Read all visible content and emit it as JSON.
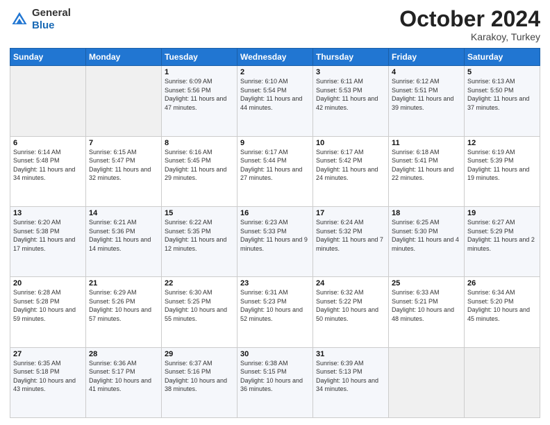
{
  "header": {
    "logo": {
      "general": "General",
      "blue": "Blue"
    },
    "title": "October 2024",
    "location": "Karakoy, Turkey"
  },
  "days_of_week": [
    "Sunday",
    "Monday",
    "Tuesday",
    "Wednesday",
    "Thursday",
    "Friday",
    "Saturday"
  ],
  "weeks": [
    [
      {
        "day": "",
        "info": ""
      },
      {
        "day": "",
        "info": ""
      },
      {
        "day": "1",
        "sunrise": "Sunrise: 6:09 AM",
        "sunset": "Sunset: 5:56 PM",
        "daylight": "Daylight: 11 hours and 47 minutes."
      },
      {
        "day": "2",
        "sunrise": "Sunrise: 6:10 AM",
        "sunset": "Sunset: 5:54 PM",
        "daylight": "Daylight: 11 hours and 44 minutes."
      },
      {
        "day": "3",
        "sunrise": "Sunrise: 6:11 AM",
        "sunset": "Sunset: 5:53 PM",
        "daylight": "Daylight: 11 hours and 42 minutes."
      },
      {
        "day": "4",
        "sunrise": "Sunrise: 6:12 AM",
        "sunset": "Sunset: 5:51 PM",
        "daylight": "Daylight: 11 hours and 39 minutes."
      },
      {
        "day": "5",
        "sunrise": "Sunrise: 6:13 AM",
        "sunset": "Sunset: 5:50 PM",
        "daylight": "Daylight: 11 hours and 37 minutes."
      }
    ],
    [
      {
        "day": "6",
        "sunrise": "Sunrise: 6:14 AM",
        "sunset": "Sunset: 5:48 PM",
        "daylight": "Daylight: 11 hours and 34 minutes."
      },
      {
        "day": "7",
        "sunrise": "Sunrise: 6:15 AM",
        "sunset": "Sunset: 5:47 PM",
        "daylight": "Daylight: 11 hours and 32 minutes."
      },
      {
        "day": "8",
        "sunrise": "Sunrise: 6:16 AM",
        "sunset": "Sunset: 5:45 PM",
        "daylight": "Daylight: 11 hours and 29 minutes."
      },
      {
        "day": "9",
        "sunrise": "Sunrise: 6:17 AM",
        "sunset": "Sunset: 5:44 PM",
        "daylight": "Daylight: 11 hours and 27 minutes."
      },
      {
        "day": "10",
        "sunrise": "Sunrise: 6:17 AM",
        "sunset": "Sunset: 5:42 PM",
        "daylight": "Daylight: 11 hours and 24 minutes."
      },
      {
        "day": "11",
        "sunrise": "Sunrise: 6:18 AM",
        "sunset": "Sunset: 5:41 PM",
        "daylight": "Daylight: 11 hours and 22 minutes."
      },
      {
        "day": "12",
        "sunrise": "Sunrise: 6:19 AM",
        "sunset": "Sunset: 5:39 PM",
        "daylight": "Daylight: 11 hours and 19 minutes."
      }
    ],
    [
      {
        "day": "13",
        "sunrise": "Sunrise: 6:20 AM",
        "sunset": "Sunset: 5:38 PM",
        "daylight": "Daylight: 11 hours and 17 minutes."
      },
      {
        "day": "14",
        "sunrise": "Sunrise: 6:21 AM",
        "sunset": "Sunset: 5:36 PM",
        "daylight": "Daylight: 11 hours and 14 minutes."
      },
      {
        "day": "15",
        "sunrise": "Sunrise: 6:22 AM",
        "sunset": "Sunset: 5:35 PM",
        "daylight": "Daylight: 11 hours and 12 minutes."
      },
      {
        "day": "16",
        "sunrise": "Sunrise: 6:23 AM",
        "sunset": "Sunset: 5:33 PM",
        "daylight": "Daylight: 11 hours and 9 minutes."
      },
      {
        "day": "17",
        "sunrise": "Sunrise: 6:24 AM",
        "sunset": "Sunset: 5:32 PM",
        "daylight": "Daylight: 11 hours and 7 minutes."
      },
      {
        "day": "18",
        "sunrise": "Sunrise: 6:25 AM",
        "sunset": "Sunset: 5:30 PM",
        "daylight": "Daylight: 11 hours and 4 minutes."
      },
      {
        "day": "19",
        "sunrise": "Sunrise: 6:27 AM",
        "sunset": "Sunset: 5:29 PM",
        "daylight": "Daylight: 11 hours and 2 minutes."
      }
    ],
    [
      {
        "day": "20",
        "sunrise": "Sunrise: 6:28 AM",
        "sunset": "Sunset: 5:28 PM",
        "daylight": "Daylight: 10 hours and 59 minutes."
      },
      {
        "day": "21",
        "sunrise": "Sunrise: 6:29 AM",
        "sunset": "Sunset: 5:26 PM",
        "daylight": "Daylight: 10 hours and 57 minutes."
      },
      {
        "day": "22",
        "sunrise": "Sunrise: 6:30 AM",
        "sunset": "Sunset: 5:25 PM",
        "daylight": "Daylight: 10 hours and 55 minutes."
      },
      {
        "day": "23",
        "sunrise": "Sunrise: 6:31 AM",
        "sunset": "Sunset: 5:23 PM",
        "daylight": "Daylight: 10 hours and 52 minutes."
      },
      {
        "day": "24",
        "sunrise": "Sunrise: 6:32 AM",
        "sunset": "Sunset: 5:22 PM",
        "daylight": "Daylight: 10 hours and 50 minutes."
      },
      {
        "day": "25",
        "sunrise": "Sunrise: 6:33 AM",
        "sunset": "Sunset: 5:21 PM",
        "daylight": "Daylight: 10 hours and 48 minutes."
      },
      {
        "day": "26",
        "sunrise": "Sunrise: 6:34 AM",
        "sunset": "Sunset: 5:20 PM",
        "daylight": "Daylight: 10 hours and 45 minutes."
      }
    ],
    [
      {
        "day": "27",
        "sunrise": "Sunrise: 6:35 AM",
        "sunset": "Sunset: 5:18 PM",
        "daylight": "Daylight: 10 hours and 43 minutes."
      },
      {
        "day": "28",
        "sunrise": "Sunrise: 6:36 AM",
        "sunset": "Sunset: 5:17 PM",
        "daylight": "Daylight: 10 hours and 41 minutes."
      },
      {
        "day": "29",
        "sunrise": "Sunrise: 6:37 AM",
        "sunset": "Sunset: 5:16 PM",
        "daylight": "Daylight: 10 hours and 38 minutes."
      },
      {
        "day": "30",
        "sunrise": "Sunrise: 6:38 AM",
        "sunset": "Sunset: 5:15 PM",
        "daylight": "Daylight: 10 hours and 36 minutes."
      },
      {
        "day": "31",
        "sunrise": "Sunrise: 6:39 AM",
        "sunset": "Sunset: 5:13 PM",
        "daylight": "Daylight: 10 hours and 34 minutes."
      },
      {
        "day": "",
        "info": ""
      },
      {
        "day": "",
        "info": ""
      }
    ]
  ]
}
